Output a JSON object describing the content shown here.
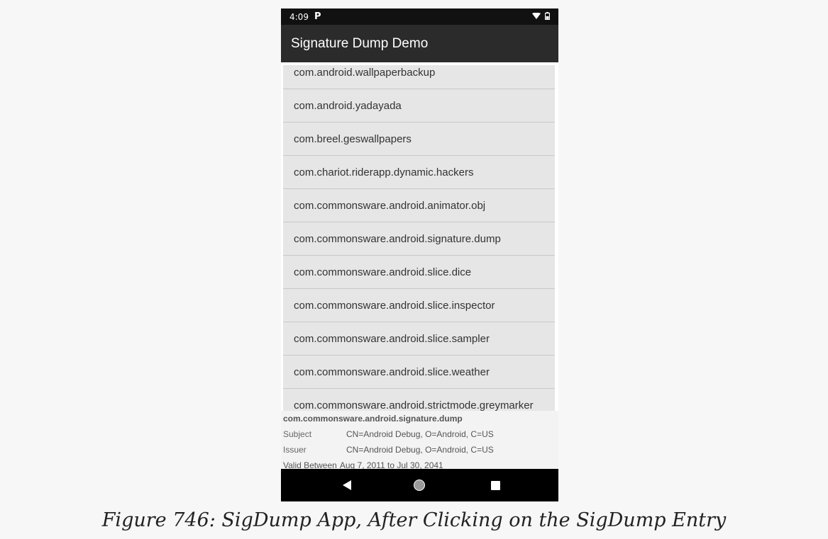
{
  "status_bar": {
    "time": "4:09",
    "notification": "P"
  },
  "app_bar": {
    "title": "Signature Dump Demo"
  },
  "packages": [
    "com.android.wallpaperbackup",
    "com.android.yadayada",
    "com.breel.geswallpapers",
    "com.chariot.riderapp.dynamic.hackers",
    "com.commonsware.android.animator.obj",
    "com.commonsware.android.signature.dump",
    "com.commonsware.android.slice.dice",
    "com.commonsware.android.slice.inspector",
    "com.commonsware.android.slice.sampler",
    "com.commonsware.android.slice.weather",
    "com.commonsware.android.strictmode.greymarker"
  ],
  "details": {
    "package": "com.commonsware.android.signature.dump",
    "subject_label": "Subject",
    "subject_value": "CN=Android Debug, O=Android, C=US",
    "issuer_label": "Issuer",
    "issuer_value": "CN=Android Debug, O=Android, C=US",
    "valid_label": "Valid Between",
    "valid_value": "Aug 7, 2011 to Jul 30, 2041"
  },
  "nav_icons": [
    "back-icon",
    "home-icon",
    "recents-icon"
  ],
  "caption": "Figure 746: SigDump App, After Clicking on the SigDump Entry",
  "colors": {
    "status_bar": "#111111",
    "app_bar": "#2b2b2b",
    "list_bg": "#e6e6e6",
    "nav_bar": "#000000"
  }
}
